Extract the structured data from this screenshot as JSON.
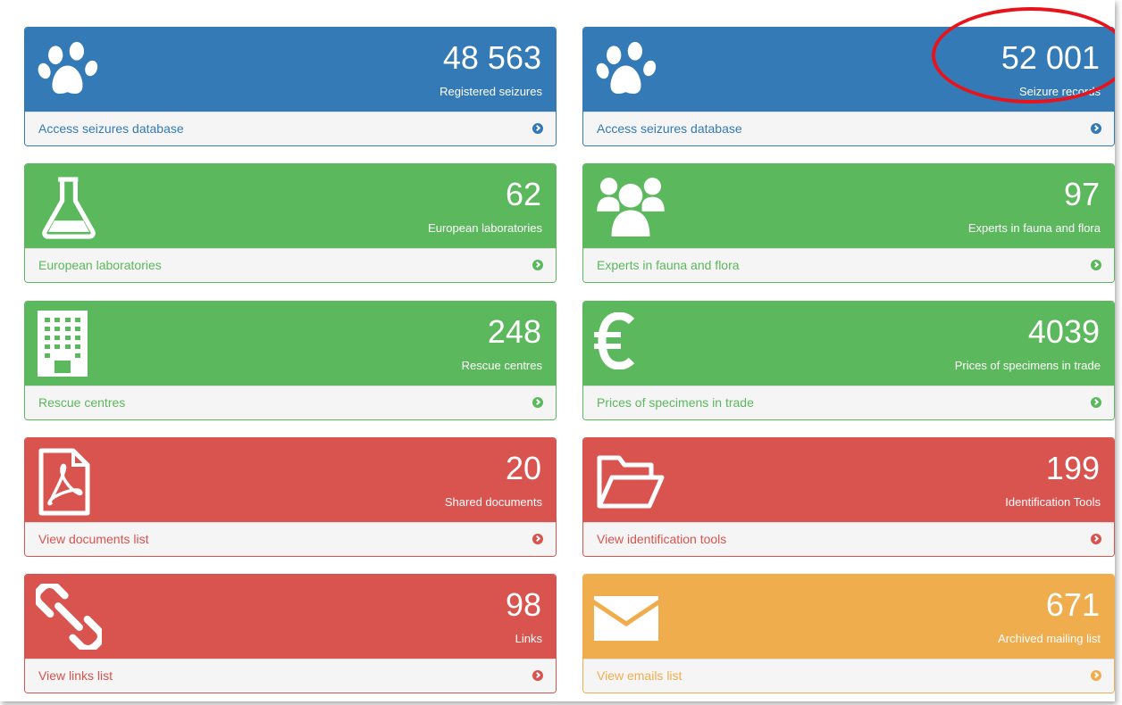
{
  "colors": {
    "blue": "#337ab7",
    "green": "#5cb85c",
    "red": "#d9534f",
    "orange": "#f0ad4e",
    "highlight": "#e8141b"
  },
  "panels": [
    {
      "id": "seizures-registered",
      "color": "blue",
      "icon": "paw-icon",
      "count": "48 563",
      "label": "Registered seizures",
      "link": "Access seizures database"
    },
    {
      "id": "seizure-records",
      "color": "blue",
      "icon": "paw-icon",
      "count": "52 001",
      "label": "Seizure records",
      "link": "Access seizures database"
    },
    {
      "id": "laboratories",
      "color": "green",
      "icon": "flask-icon",
      "count": "62",
      "label": "European laboratories",
      "link": "European laboratories"
    },
    {
      "id": "experts",
      "color": "green",
      "icon": "users-icon",
      "count": "97",
      "label": "Experts in fauna and flora",
      "link": "Experts in fauna and flora"
    },
    {
      "id": "rescue-centres",
      "color": "green",
      "icon": "building-icon",
      "count": "248",
      "label": "Rescue centres",
      "link": "Rescue centres"
    },
    {
      "id": "prices",
      "color": "green",
      "icon": "euro-icon",
      "count": "4039",
      "label": "Prices of specimens in trade",
      "link": "Prices of specimens in trade"
    },
    {
      "id": "documents",
      "color": "red",
      "icon": "pdf-file-icon",
      "count": "20",
      "label": "Shared documents",
      "link": "View documents list"
    },
    {
      "id": "identification-tools",
      "color": "red",
      "icon": "folder-open-icon",
      "count": "199",
      "label": "Identification Tools",
      "link": "View identification tools"
    },
    {
      "id": "links",
      "color": "red",
      "icon": "link-icon",
      "count": "98",
      "label": "Links",
      "link": "View links list"
    },
    {
      "id": "mailing-list",
      "color": "orange",
      "icon": "envelope-icon",
      "count": "671",
      "label": "Archived mailing list",
      "link": "View emails list"
    }
  ],
  "annotation": {
    "icon": "highlight-circle",
    "color": "#e8141b"
  }
}
